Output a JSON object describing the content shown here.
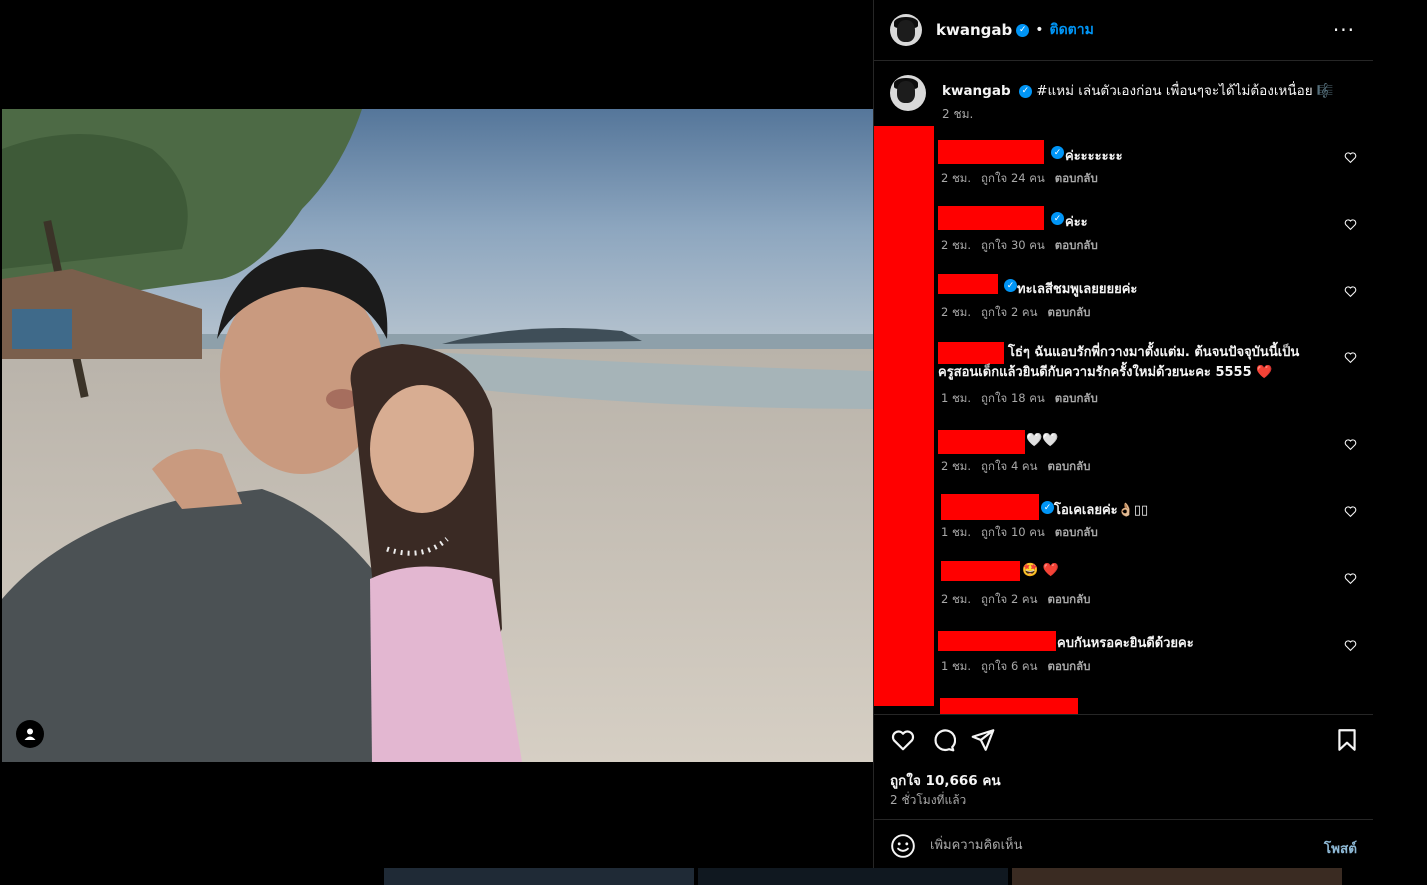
{
  "post": {
    "author": "kwangab",
    "follow_label": "ติดตาม",
    "dot": "•",
    "more": "···",
    "caption": "#แหม่ เล่นตัวเองก่อน เพื่อนๆจะได้ไม่ต้องเหนื่อย 🎼",
    "caption_time": "2 ชม.",
    "likes": "ถูกใจ 10,666 คน",
    "posted_ago": "2 ชั่วโมงที่แล้ว",
    "comment_placeholder": "เพิ่มความคิดเห็น",
    "post_button": "โพสต์"
  },
  "comments": [
    {
      "text": "ค่ะะะะะะะ",
      "time": "2 ชม.",
      "likes": "ถูกใจ 24 คน",
      "reply": "ตอบกลับ"
    },
    {
      "text": "ค่ะะ",
      "time": "2 ชม.",
      "likes": "ถูกใจ 30 คน",
      "reply": "ตอบกลับ"
    },
    {
      "text": "ทะเลสีชมพูเลยยยยค่ะ",
      "time": "2 ชม.",
      "likes": "ถูกใจ 2 คน",
      "reply": "ตอบกลับ"
    },
    {
      "text": "โธ่ๆ ฉันแอบรักพี่กวางมาตั้งแต่ม. ต้นจนปัจจุบันนี้เป็นครูสอนเด็กแล้วยินดีกับความรักครั้งใหม่ด้วยนะคะ 5555 ❤️",
      "time": "1 ชม.",
      "likes": "ถูกใจ 18 คน",
      "reply": "ตอบกลับ"
    },
    {
      "text": "🤍🤍",
      "time": "2 ชม.",
      "likes": "ถูกใจ 4 คน",
      "reply": "ตอบกลับ"
    },
    {
      "text": "โอเคเลยค่ะ👌🏼▯▯",
      "time": "1 ชม.",
      "likes": "ถูกใจ 10 คน",
      "reply": "ตอบกลับ"
    },
    {
      "text": "🤩 ❤️",
      "time": "2 ชม.",
      "likes": "ถูกใจ 2 คน",
      "reply": "ตอบกลับ"
    },
    {
      "text": "คบกันหรอคะยินดีด้วยคะ",
      "time": "1 ชม.",
      "likes": "ถูกใจ 6 คน",
      "reply": "ตอบกลับ"
    }
  ],
  "colors": {
    "accent": "#0095f6",
    "redaction": "#ff0000",
    "muted": "#a8a8a8"
  }
}
